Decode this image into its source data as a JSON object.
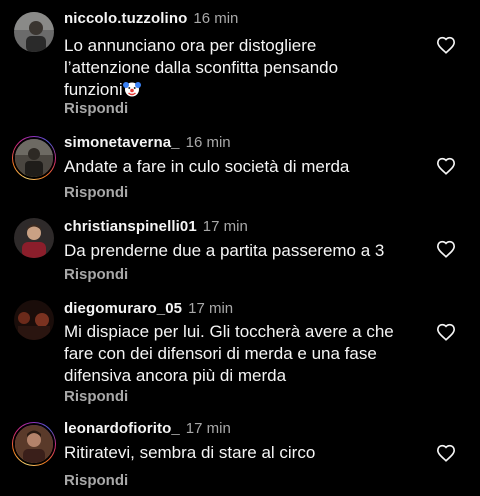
{
  "comments": [
    {
      "username": "niccolo.tuzzolino",
      "time": "16 min",
      "lines": [
        "Lo annunciano ora per distogliere",
        "l’attenzione dalla sconfitta pensando",
        "funzioni"
      ],
      "emoji": "clown-face-emoji",
      "reply_label": "Rispondi",
      "like_icon": "heart-outline-icon"
    },
    {
      "username": "simonetaverna_",
      "time": "16 min",
      "lines": [
        "Andate a fare in culo società di merda"
      ],
      "reply_label": "Rispondi",
      "like_icon": "heart-outline-icon"
    },
    {
      "username": "christianspinelli01",
      "time": "17 min",
      "lines": [
        "Da prenderne due a partita passeremo a 3"
      ],
      "reply_label": "Rispondi",
      "like_icon": "heart-outline-icon"
    },
    {
      "username": "diegomuraro_05",
      "time": "17 min",
      "lines": [
        "Mi dispiace per lui. Gli toccherà avere a che",
        "fare con dei difensori di merda e una fase",
        "difensiva ancora più di merda"
      ],
      "reply_label": "Rispondi",
      "like_icon": "heart-outline-icon"
    },
    {
      "username": "leonardofiorito_",
      "time": "17 min",
      "lines": [
        "Ritiratevi, sembra di stare al circo"
      ],
      "reply_label": "Rispondi",
      "like_icon": "heart-outline-icon"
    }
  ],
  "colors": {
    "background": "#000000",
    "primary_text": "#f5f5f5",
    "secondary_text": "#a8a8a8"
  }
}
